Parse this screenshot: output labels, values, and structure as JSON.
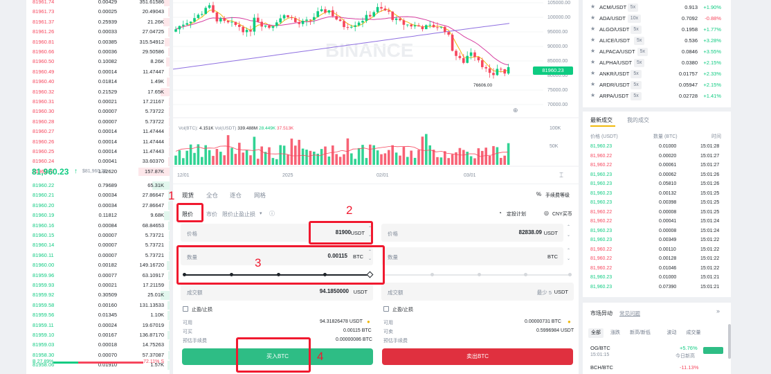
{
  "orderbook": {
    "asks": [
      {
        "price": "81961.74",
        "amount": "0.00429",
        "total": "351.61586",
        "depth": 0.18
      },
      {
        "price": "81961.73",
        "amount": "0.00025",
        "total": "20.49043",
        "depth": 0.05
      },
      {
        "price": "81961.37",
        "amount": "0.25939",
        "total": "21.26K",
        "depth": 0.2
      },
      {
        "price": "81961.26",
        "amount": "0.00033",
        "total": "27.04725",
        "depth": 0.05
      },
      {
        "price": "81960.81",
        "amount": "0.00385",
        "total": "315.54912",
        "depth": 0.16
      },
      {
        "price": "81960.66",
        "amount": "0.00036",
        "total": "29.50586",
        "depth": 0.05
      },
      {
        "price": "81960.50",
        "amount": "0.10082",
        "total": "8.26K",
        "depth": 0.12
      },
      {
        "price": "81960.49",
        "amount": "0.00014",
        "total": "11.47447",
        "depth": 0.03
      },
      {
        "price": "81960.40",
        "amount": "0.01814",
        "total": "1.49K",
        "depth": 0.08
      },
      {
        "price": "81960.32",
        "amount": "0.21529",
        "total": "17.65K",
        "depth": 0.3
      },
      {
        "price": "81960.31",
        "amount": "0.00021",
        "total": "17.21167",
        "depth": 0.03
      },
      {
        "price": "81960.30",
        "amount": "0.00007",
        "total": "5.73722",
        "depth": 0.02
      },
      {
        "price": "81960.28",
        "amount": "0.00007",
        "total": "5.73722",
        "depth": 0.02
      },
      {
        "price": "81960.27",
        "amount": "0.00014",
        "total": "11.47444",
        "depth": 0.03
      },
      {
        "price": "81960.26",
        "amount": "0.00014",
        "total": "11.47444",
        "depth": 0.03
      },
      {
        "price": "81960.25",
        "amount": "0.00014",
        "total": "11.47443",
        "depth": 0.03
      },
      {
        "price": "81960.24",
        "amount": "0.00041",
        "total": "33.60370",
        "depth": 0.05
      },
      {
        "price": "81960.23",
        "amount": "1.92620",
        "total": "157.87K",
        "depth": 1.0
      }
    ],
    "last_price": "81,960.23",
    "last_arrow": "↑",
    "last_sub": "$81,960.23",
    "bids": [
      {
        "price": "81960.22",
        "amount": "0.79689",
        "total": "65.31K",
        "depth": 0.55
      },
      {
        "price": "81960.21",
        "amount": "0.00034",
        "total": "27.86647",
        "depth": 0.04
      },
      {
        "price": "81960.20",
        "amount": "0.00034",
        "total": "27.86647",
        "depth": 0.04
      },
      {
        "price": "81960.19",
        "amount": "0.11812",
        "total": "9.68K",
        "depth": 0.18
      },
      {
        "price": "81960.16",
        "amount": "0.00084",
        "total": "68.84653",
        "depth": 0.05
      },
      {
        "price": "81960.15",
        "amount": "0.00007",
        "total": "5.73721",
        "depth": 0.02
      },
      {
        "price": "81960.14",
        "amount": "0.00007",
        "total": "5.73721",
        "depth": 0.02
      },
      {
        "price": "81960.11",
        "amount": "0.00007",
        "total": "5.73721",
        "depth": 0.02
      },
      {
        "price": "81960.00",
        "amount": "0.00182",
        "total": "149.16720",
        "depth": 0.08
      },
      {
        "price": "81959.96",
        "amount": "0.00077",
        "total": "63.10917",
        "depth": 0.04
      },
      {
        "price": "81959.93",
        "amount": "0.00021",
        "total": "17.21159",
        "depth": 0.03
      },
      {
        "price": "81959.92",
        "amount": "0.30509",
        "total": "25.01K",
        "depth": 0.3
      },
      {
        "price": "81959.58",
        "amount": "0.00160",
        "total": "131.13533",
        "depth": 0.06
      },
      {
        "price": "81959.56",
        "amount": "0.01345",
        "total": "1.10K",
        "depth": 0.06
      },
      {
        "price": "81959.11",
        "amount": "0.00024",
        "total": "19.67019",
        "depth": 0.03
      },
      {
        "price": "81959.10",
        "amount": "0.00167",
        "total": "136.87170",
        "depth": 0.06
      },
      {
        "price": "81959.03",
        "amount": "0.00018",
        "total": "14.75263",
        "depth": 0.03
      },
      {
        "price": "81958.30",
        "amount": "0.00070",
        "total": "57.37087",
        "depth": 0.04
      },
      {
        "price": "81958.06",
        "amount": "0.01910",
        "total": "1.57K",
        "depth": 0.06
      }
    ],
    "ratio_buy": "B 27.89%",
    "ratio_sell": "72.11% S",
    "ratio_buy_fraction": 0.2789
  },
  "chart": {
    "watermark": "BINANCE",
    "price_ticks": [
      "105000.00",
      "100000.00",
      "95000.00",
      "90000.00",
      "85000.00",
      "80000.00",
      "75000.00",
      "70000.00"
    ],
    "current_price": "81960.23",
    "low_label": "76606.00",
    "vol_header": {
      "label_btc": "Vol(BTC):",
      "val_btc": "4.151K",
      "label_usdt": "Vol(USDT)",
      "val_usdt": "339.488M",
      "ma1": "28.449K",
      "ma2": "37.513K"
    },
    "vol_ticks": [
      "100K",
      "50K"
    ],
    "dates": [
      "12/01",
      "2025",
      "02/01",
      "03/01"
    ],
    "colors": {
      "up": "#0ecb81",
      "down": "#f6465d",
      "ma7": "#f0b90b",
      "ma25": "#d63ea0",
      "ma99": "#8e6fe0"
    }
  },
  "trade": {
    "tabs": [
      "现货",
      "全仓",
      "逐仓",
      "网格"
    ],
    "fee_label": "手续费等级",
    "order_types": {
      "limit": "限价",
      "market": "市价",
      "stop": "限价止盈止损"
    },
    "plan_label": "定投计划",
    "cny_label": "CNY买币",
    "buy": {
      "price_label": "价格",
      "price_value": "81900",
      "price_unit": "USDT",
      "qty_label": "数量",
      "qty_value": "0.00115",
      "qty_unit": "BTC",
      "total_label": "成交额",
      "total_value": "94.1850000",
      "total_unit": "USDT",
      "tpsl_label": "止盈/止损",
      "avail_label": "可用",
      "avail_value": "94.31826478 USDT",
      "max_label": "可买",
      "max_value": "0.00115 BTC",
      "fee_label": "预估手续费",
      "fee_value": "0.00000086 BTC",
      "button": "买入BTC"
    },
    "sell": {
      "price_label": "价格",
      "price_value": "82838.09",
      "price_unit": "USDT",
      "qty_label": "数量",
      "qty_unit": "BTC",
      "total_label": "成交额",
      "total_hint": "最少 5",
      "total_unit": "USDT",
      "tpsl_label": "止盈/止损",
      "avail_label": "可用",
      "avail_value": "0.00000731 BTC",
      "max_label": "可卖",
      "max_value": "0.5996984 USDT",
      "fee_label": "预估手续费",
      "button": "卖出BTC"
    },
    "annotations": [
      "1",
      "2",
      "3",
      "4"
    ]
  },
  "markets": [
    {
      "pair": "ACM/USDT",
      "lev": "5x",
      "price": "0.913",
      "change": "+1.90%",
      "dir": "up"
    },
    {
      "pair": "ADA/USDT",
      "lev": "10x",
      "price": "0.7092",
      "change": "-0.88%",
      "dir": "down"
    },
    {
      "pair": "ALGO/USDT",
      "lev": "5x",
      "price": "0.1958",
      "change": "+1.77%",
      "dir": "up"
    },
    {
      "pair": "ALICE/USDT",
      "lev": "5x",
      "price": "0.536",
      "change": "+3.28%",
      "dir": "up"
    },
    {
      "pair": "ALPACA/USDT",
      "lev": "5x",
      "price": "0.0846",
      "change": "+3.55%",
      "dir": "up"
    },
    {
      "pair": "ALPHA/USDT",
      "lev": "5x",
      "price": "0.0380",
      "change": "+2.15%",
      "dir": "up"
    },
    {
      "pair": "ANKR/USDT",
      "lev": "5x",
      "price": "0.01757",
      "change": "+2.33%",
      "dir": "up"
    },
    {
      "pair": "ARDR/USDT",
      "lev": "5x",
      "price": "0.05947",
      "change": "+2.15%",
      "dir": "up"
    },
    {
      "pair": "ARPA/USDT",
      "lev": "5x",
      "price": "0.02728",
      "change": "+1.41%",
      "dir": "up"
    }
  ],
  "trades_panel": {
    "tab_latest": "最新成交",
    "tab_mine": "我的成交",
    "col_price": "价格 (USDT)",
    "col_qty": "数量 (BTC)",
    "col_time": "时间",
    "rows": [
      {
        "price": "81,960.23",
        "qty": "0.01000",
        "time": "15:01:28",
        "dir": "up"
      },
      {
        "price": "81,960.22",
        "qty": "0.00020",
        "time": "15:01:27",
        "dir": "down"
      },
      {
        "price": "81,960.22",
        "qty": "0.00061",
        "time": "15:01:27",
        "dir": "down"
      },
      {
        "price": "81,960.23",
        "qty": "0.00062",
        "time": "15:01:26",
        "dir": "up"
      },
      {
        "price": "81,960.23",
        "qty": "0.05810",
        "time": "15:01:26",
        "dir": "up"
      },
      {
        "price": "81,960.23",
        "qty": "0.00132",
        "time": "15:01:25",
        "dir": "up"
      },
      {
        "price": "81,960.23",
        "qty": "0.00398",
        "time": "15:01:25",
        "dir": "up"
      },
      {
        "price": "81,960.22",
        "qty": "0.00008",
        "time": "15:01:25",
        "dir": "down"
      },
      {
        "price": "81,960.22",
        "qty": "0.00041",
        "time": "15:01:24",
        "dir": "down"
      },
      {
        "price": "81,960.23",
        "qty": "0.00008",
        "time": "15:01:24",
        "dir": "up"
      },
      {
        "price": "81,960.23",
        "qty": "0.00349",
        "time": "15:01:22",
        "dir": "up"
      },
      {
        "price": "81,960.22",
        "qty": "0.00110",
        "time": "15:01:22",
        "dir": "down"
      },
      {
        "price": "81,960.22",
        "qty": "0.00128",
        "time": "15:01:22",
        "dir": "down"
      },
      {
        "price": "81,960.22",
        "qty": "0.01046",
        "time": "15:01:22",
        "dir": "down"
      },
      {
        "price": "81,960.23",
        "qty": "0.01000",
        "time": "15:01:21",
        "dir": "up"
      },
      {
        "price": "81,960.23",
        "qty": "0.07390",
        "time": "15:01:21",
        "dir": "up"
      }
    ]
  },
  "movers": {
    "title": "市场异动",
    "link": "常见问题",
    "tabs": [
      "全部",
      "涨跌",
      "新高/新低",
      "波动",
      "成交量"
    ],
    "items": [
      {
        "pair": "OG/BTC",
        "time": "15:01:15",
        "change": "+5.76%",
        "note": "今日新高",
        "dir": "up"
      },
      {
        "pair": "BCH/BTC",
        "change": "-11.13%",
        "dir": "down"
      }
    ]
  }
}
